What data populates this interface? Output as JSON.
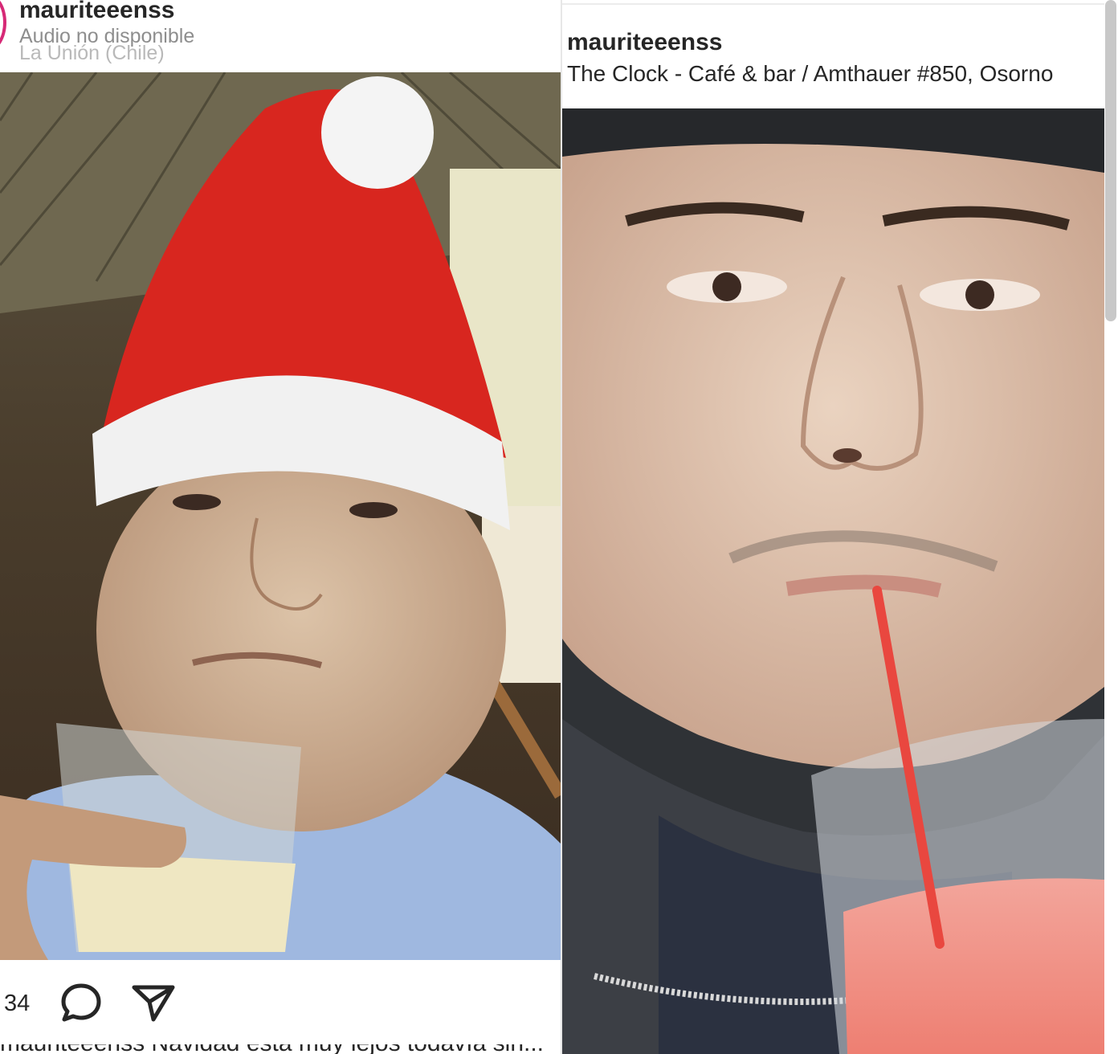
{
  "left_post": {
    "username": "mauriteeenss",
    "audio_label": "Audio no disponible",
    "location": "La Unión (Chile)",
    "likes": "34",
    "caption_preview": "mauriteeenss Navidad está muy lejos todavía sin..."
  },
  "right_post": {
    "username": "mauriteeenss",
    "location": "The Clock - Café & bar / Amthauer #850, Osorno"
  },
  "icons": {
    "comment": "comment-icon",
    "share": "send-icon"
  },
  "colors": {
    "text_primary": "#262626",
    "text_secondary": "#8e8e8e",
    "story_ring": "#d62976"
  }
}
